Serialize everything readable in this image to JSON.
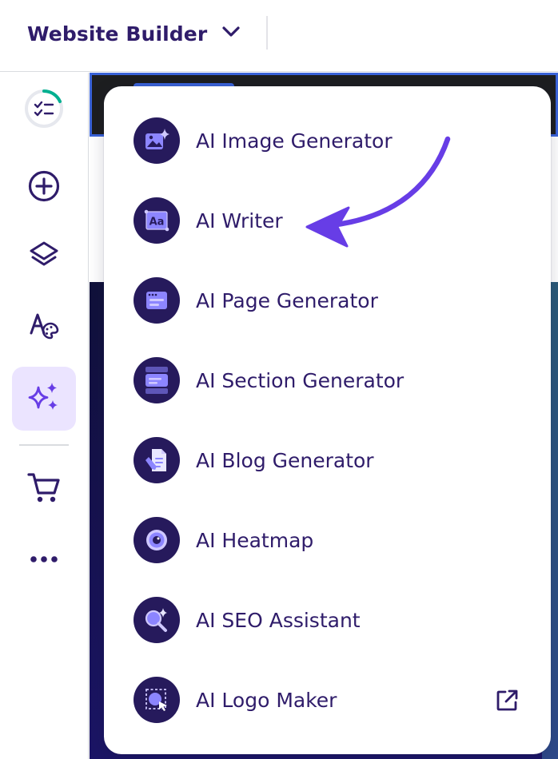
{
  "header": {
    "app_title": "Website Builder",
    "app_switch_icon": "chevron-down-icon"
  },
  "sidebar": {
    "items": [
      {
        "name": "checklist-progress",
        "icon": "checklist-progress-icon",
        "active": false
      },
      {
        "name": "add-element",
        "icon": "plus-circle-icon",
        "active": false
      },
      {
        "name": "layers",
        "icon": "layers-icon",
        "active": false
      },
      {
        "name": "styles",
        "icon": "text-palette-icon",
        "active": false
      },
      {
        "name": "ai-tools",
        "icon": "sparkles-icon",
        "active": true
      },
      {
        "name": "store",
        "icon": "shopping-cart-icon",
        "active": false
      },
      {
        "name": "more",
        "icon": "more-horizontal-icon",
        "active": false
      }
    ]
  },
  "ai_menu": {
    "items": [
      {
        "label": "AI Image Generator",
        "icon": "image-sparkle-icon"
      },
      {
        "label": "AI Writer",
        "icon": "text-aa-icon"
      },
      {
        "label": "AI Page Generator",
        "icon": "browser-page-icon"
      },
      {
        "label": "AI Section Generator",
        "icon": "section-blocks-icon"
      },
      {
        "label": "AI Blog Generator",
        "icon": "document-pen-icon"
      },
      {
        "label": "AI Heatmap",
        "icon": "eye-target-icon"
      },
      {
        "label": "AI SEO Assistant",
        "icon": "magnifier-sparkle-icon"
      },
      {
        "label": "AI Logo Maker",
        "icon": "logo-select-cursor-icon",
        "external_icon": "external-link-icon"
      }
    ],
    "highlighted_item": "AI Writer"
  },
  "colors": {
    "brand_dark": "#2f1c6a",
    "icon_bg": "#261a5c",
    "icon_accent": "#8c85ff",
    "active_bg": "#ebe4ff",
    "accent_purple": "#673de6",
    "progress_green": "#00b090"
  }
}
